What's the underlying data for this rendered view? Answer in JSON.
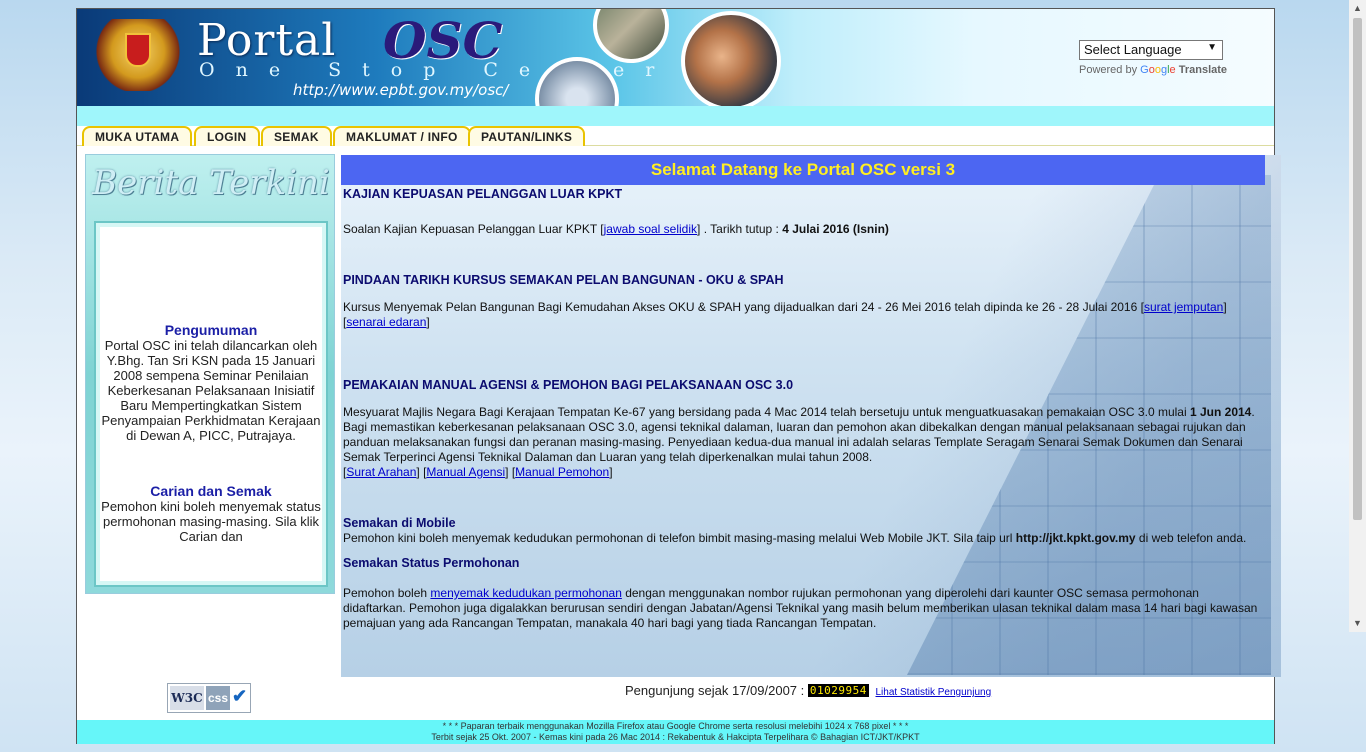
{
  "header": {
    "logo_portal": "Portal",
    "logo_osc": "OSC",
    "tagline": "One Stop Center",
    "url": "http://www.epbt.gov.my/osc/",
    "language_select": "Select Language",
    "powered_by": "Powered by",
    "google": [
      "G",
      "o",
      "o",
      "g",
      "l",
      "e"
    ],
    "translate": "Translate"
  },
  "nav": {
    "tabs": [
      "MUKA UTAMA",
      "LOGIN",
      "SEMAK",
      "MAKLUMAT / INFO",
      "PAUTAN/LINKS"
    ]
  },
  "sidebar": {
    "title": "Berita Terkini",
    "items": [
      {
        "heading": "Pengumuman",
        "text": "Portal OSC ini telah dilancarkan oleh Y.Bhg. Tan Sri KSN pada 15 Januari 2008 sempena Seminar Penilaian Keberkesanan Pelaksanaan Inisiatif Baru Mempertingkatkan Sistem Penyampaian Perkhidmatan Kerajaan di Dewan A, PICC, Putrajaya."
      },
      {
        "heading": "Carian dan Semak",
        "text": "Pemohon kini boleh menyemak status permohonan masing-masing. Sila klik Carian dan"
      }
    ]
  },
  "main": {
    "title": "Selamat Datang ke Portal OSC versi 3",
    "s1": {
      "heading": "KAJIAN KEPUASAN PELANGGAN LUAR KPKT",
      "text_a": "Soalan Kajian Kepuasan Pelanggan Luar KPKT [",
      "link": "jawab soal selidik",
      "text_b": "] . Tarikh tutup : ",
      "bold": "4 Julai 2016 (Isnin)"
    },
    "s2": {
      "heading": "PINDAAN TARIKH KURSUS SEMAKAN PELAN BANGUNAN - OKU & SPAH",
      "text_a": "Kursus Menyemak Pelan Bangunan Bagi Kemudahan Akses OKU & SPAH yang dijadualkan dari 24 - 26 Mei 2016 telah dipinda ke 26 - 28 Julai 2016 [",
      "link1": "surat jemputan",
      "mid": "] [",
      "link2": "senarai edaran",
      "end": "]"
    },
    "s3": {
      "heading": "PEMAKAIAN MANUAL AGENSI & PEMOHON BAGI PELAKSANAAN OSC 3.0",
      "text_a": "Mesyuarat Majlis Negara Bagi Kerajaan Tempatan Ke-67 yang bersidang pada 4 Mac 2014 telah bersetuju untuk menguatkuasakan pemakaian OSC 3.0 mulai ",
      "bold": "1 Jun 2014",
      "text_b": ". Bagi memastikan keberkesanan pelaksanaan OSC 3.0, agensi teknikal dalaman, luaran dan pemohon akan dibekalkan dengan manual pelaksanaan sebagai rujukan dan panduan melaksanakan fungsi dan peranan masing-masing. Penyediaan kedua-dua manual ini adalah selaras Template Seragam Senarai Semak Dokumen dan Senarai Semak Terperinci Agensi Teknikal Dalaman dan Luaran yang telah diperkenalkan mulai tahun 2008.",
      "link1": "Surat Arahan",
      "link2": "Manual Agensi",
      "link3": "Manual Pemohon"
    },
    "s4": {
      "heading": "Semakan di Mobile",
      "text_a": "Pemohon kini boleh menyemak kedudukan permohonan di telefon bimbit masing-masing melalui Web Mobile JKT. Sila taip url ",
      "bold": "http://jkt.kpkt.gov.my",
      "text_b": " di web telefon anda."
    },
    "s5": {
      "heading": "Semakan Status Permohonan",
      "text_a": "Pemohon boleh ",
      "link": "menyemak kedudukan permohonan",
      "text_b": " dengan menggunakan nombor rujukan permohonan yang diperolehi dari kaunter OSC semasa permohonan didaftarkan. Pemohon juga digalakkan berurusan sendiri dengan Jabatan/Agensi Teknikal yang masih belum memberikan ulasan teknikal dalam masa 14 hari bagi kawasan pemajuan yang ada Rancangan Tempatan, manakala 40 hari bagi yang tiada Rancangan Tempatan."
    }
  },
  "bottom": {
    "w3c_w3": "W3C",
    "w3c_css": "css",
    "visitor_label": "Pengunjung sejak 17/09/2007 :",
    "counter": "01029954",
    "stats_link": "Lihat Statistik Pengunjung"
  },
  "footer": {
    "line1": "* * * Paparan terbaik menggunakan Mozilla Firefox atau Google Chrome serta resolusi melebihi 1024 x 768 pixel * * *",
    "line2": "Terbit sejak 25 Okt. 2007 - Kemas kini pada 26 Mac 2014 : Rekabentuk & Hakcipta Terpelihara © Bahagian ICT/JKT/KPKT"
  },
  "colors": {
    "title_bar": "#4c66f2",
    "title_text": "#ffee22",
    "tab_border": "#e9c300",
    "footer": "#66f6f9"
  }
}
